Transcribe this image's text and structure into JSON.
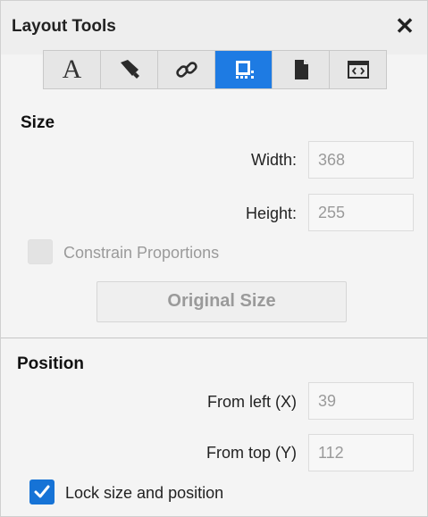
{
  "panel": {
    "title": "Layout Tools",
    "close_symbol": "✕"
  },
  "toolbar": {
    "tools": [
      {
        "name": "text-tool",
        "icon": "letter-a-icon",
        "glyph": "A",
        "active": false
      },
      {
        "name": "style-tool",
        "icon": "paintbrush-icon",
        "active": false
      },
      {
        "name": "link-tool",
        "icon": "link-icon",
        "active": false
      },
      {
        "name": "layout-tool",
        "icon": "layout-icon",
        "active": true
      },
      {
        "name": "page-tool",
        "icon": "page-icon",
        "active": false
      },
      {
        "name": "code-tool",
        "icon": "code-window-icon",
        "active": false
      }
    ],
    "active_color": "#1e7be3"
  },
  "size": {
    "title": "Size",
    "width_label": "Width:",
    "width_value": "368",
    "height_label": "Height:",
    "height_value": "255",
    "constrain_label": "Constrain Proportions",
    "constrain_checked": false,
    "original_size_label": "Original Size"
  },
  "position": {
    "title": "Position",
    "left_label": "From left (X)",
    "left_value": "39",
    "top_label": "From top (Y)",
    "top_value": "112",
    "lock_label": "Lock size and position",
    "lock_checked": true
  },
  "colors": {
    "accent": "#1673d6"
  }
}
